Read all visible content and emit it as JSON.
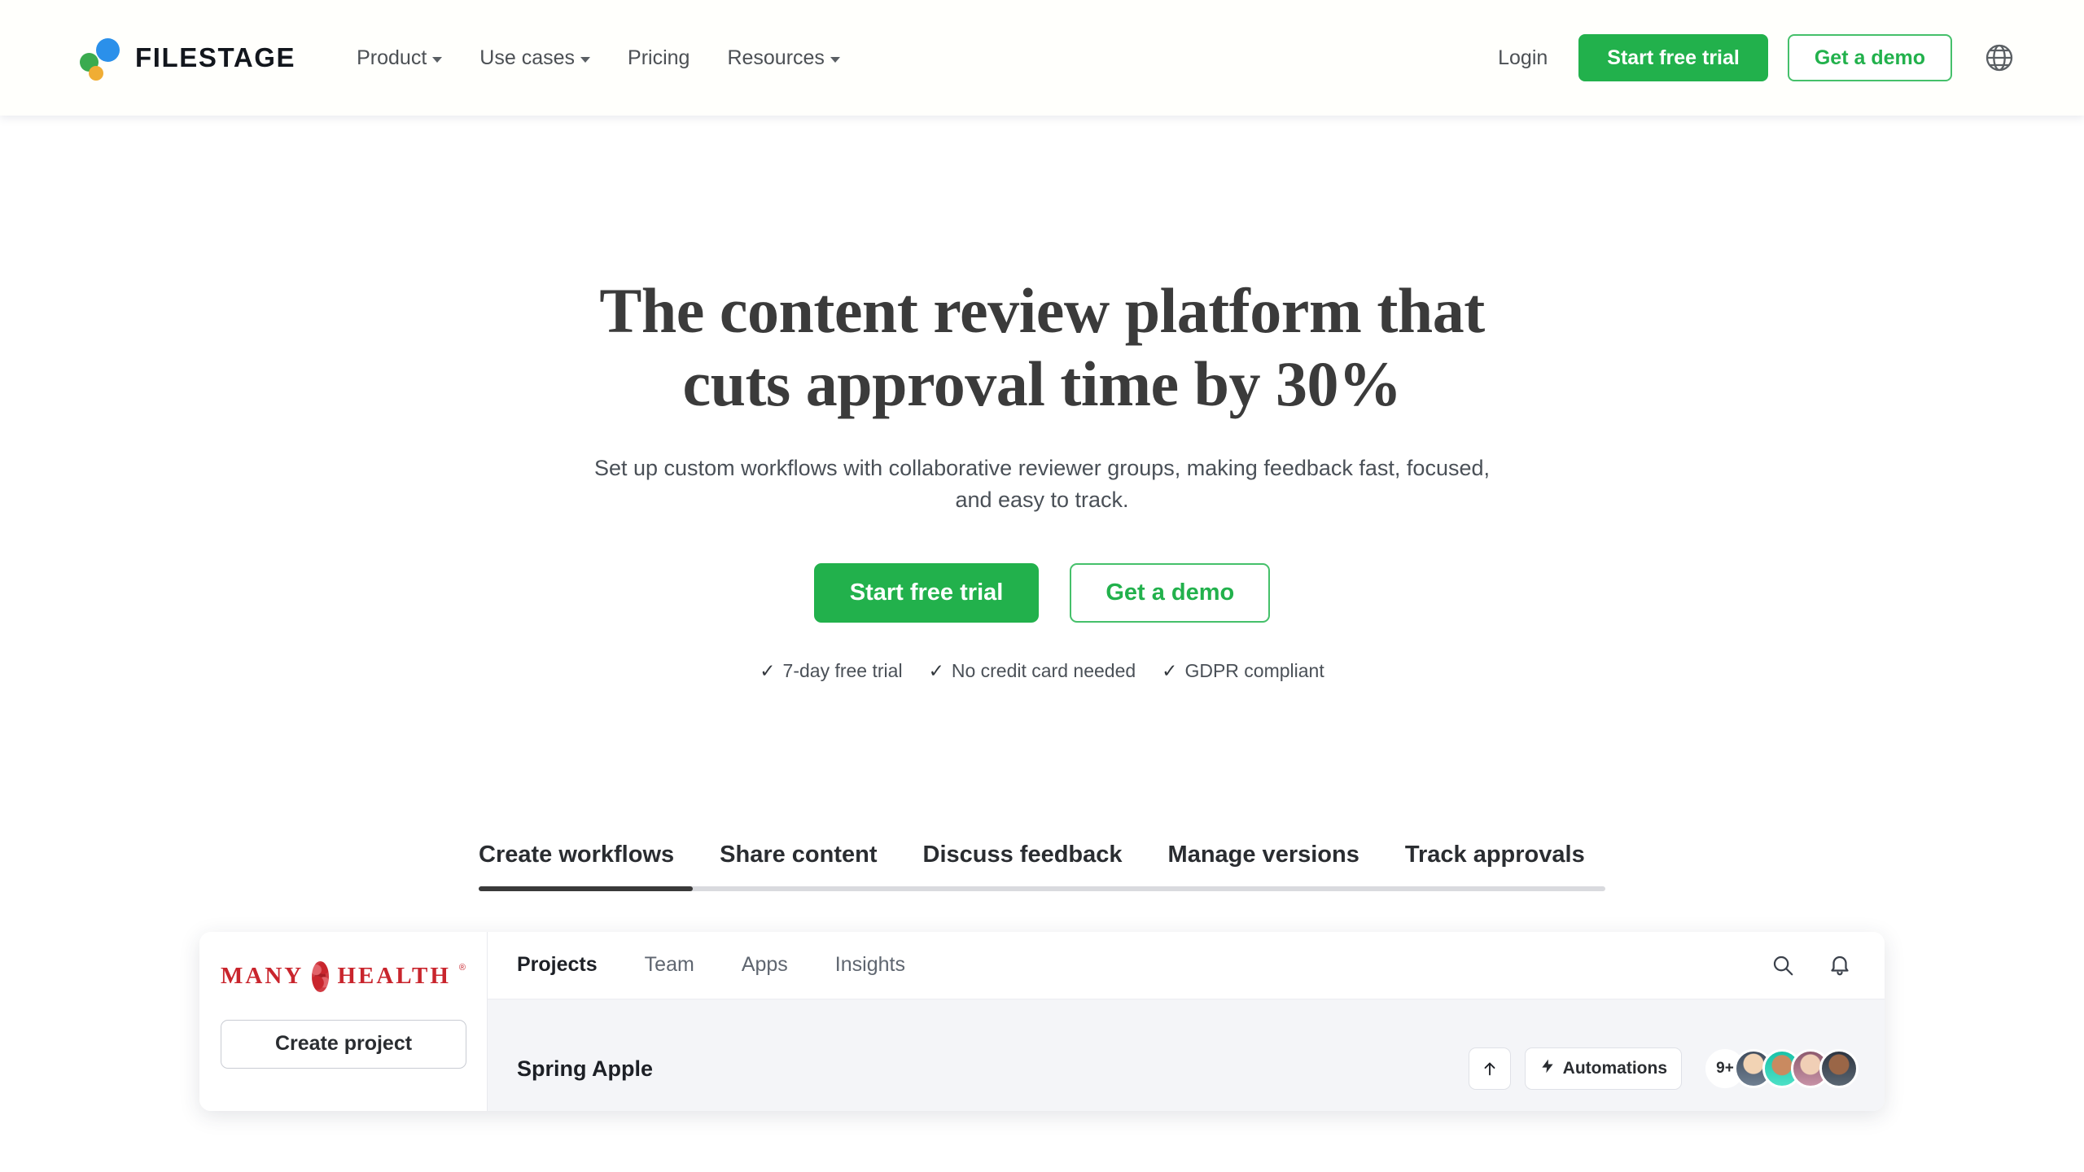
{
  "header": {
    "brand": {
      "name": "FILESTAGE",
      "logo_icon": "filestage-dots-logo"
    },
    "nav": [
      {
        "label": "Product",
        "has_dropdown": true
      },
      {
        "label": "Use cases",
        "has_dropdown": true
      },
      {
        "label": "Pricing",
        "has_dropdown": false
      },
      {
        "label": "Resources",
        "has_dropdown": true
      }
    ],
    "login_label": "Login",
    "start_trial_label": "Start free trial",
    "demo_label": "Get a demo",
    "language_icon": "globe-icon"
  },
  "hero": {
    "title_line1": "The content review platform that",
    "title_line2": "cuts approval time by 30%",
    "subtitle": "Set up custom workflows with collaborative reviewer groups, making feedback fast, focused, and easy to track.",
    "primary_cta": "Start free trial",
    "secondary_cta": "Get a demo",
    "trust_items": [
      {
        "check": "✓",
        "label": "7-day free trial"
      },
      {
        "check": "✓",
        "label": "No credit card needed"
      },
      {
        "check": "✓",
        "label": "GDPR compliant"
      }
    ]
  },
  "feature_tabs": {
    "items": [
      "Create workflows",
      "Share content",
      "Discuss feedback",
      "Manage versions",
      "Track approvals"
    ],
    "active_index": 0
  },
  "app_preview": {
    "workspace": {
      "name_left": "MANY",
      "name_right": "HEALTH",
      "registered_mark": "®",
      "logo_icon": "many-health-blob-logo"
    },
    "create_project_label": "Create project",
    "tabs": [
      {
        "label": "Projects",
        "active": true
      },
      {
        "label": "Team",
        "active": false
      },
      {
        "label": "Apps",
        "active": false
      },
      {
        "label": "Insights",
        "active": false
      }
    ],
    "topbar_icons": [
      {
        "icon": "search-icon"
      },
      {
        "icon": "bell-icon"
      }
    ],
    "project_title": "Spring Apple",
    "upload_icon": "upload-arrow-icon",
    "automations_label": "Automations",
    "automations_icon": "automations-bolt-icon",
    "member_overflow_count": "9+"
  },
  "colors": {
    "brand_green": "#22b14c",
    "brand_green_border": "#45c06a",
    "logo_blue": "#2b90ea",
    "logo_green": "#3aab4f",
    "logo_orange": "#f0ad34",
    "heading_gray": "#3b3b3b",
    "body_gray": "#4a5057",
    "tab_active": "#3a3a3a",
    "tab_track": "#d9dade",
    "workspace_red": "#c9252d"
  }
}
